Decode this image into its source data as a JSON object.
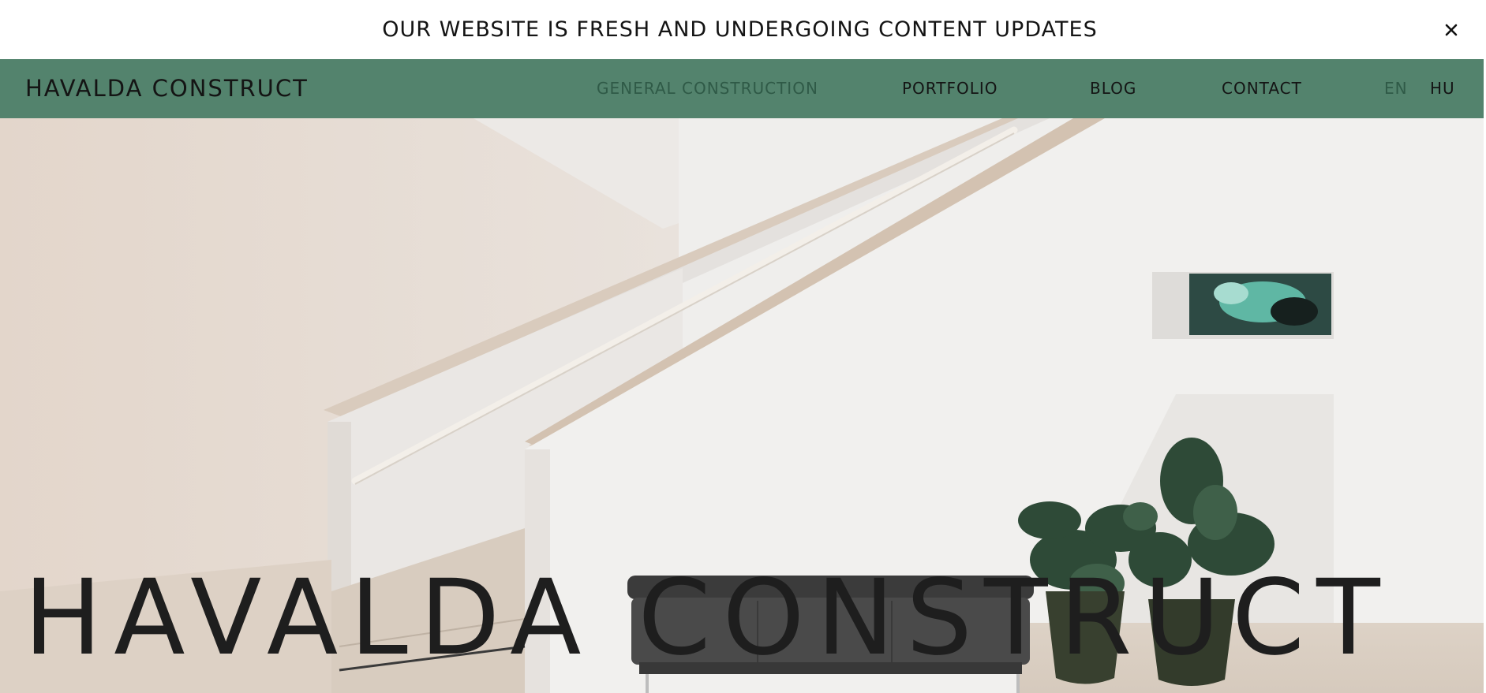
{
  "announcement": {
    "text": "OUR WEBSITE IS FRESH AND UNDERGOING CONTENT UPDATES",
    "close_icon": "close-icon"
  },
  "nav": {
    "logo": "HAVALDA CONSTRUCT",
    "links": [
      {
        "label": "GENERAL CONSTRUCTION",
        "active": true
      },
      {
        "label": "PORTFOLIO",
        "active": false
      },
      {
        "label": "BLOG",
        "active": false
      },
      {
        "label": "CONTACT",
        "active": false
      }
    ],
    "languages": [
      {
        "label": "EN",
        "selected": true
      },
      {
        "label": "HU",
        "selected": false
      }
    ]
  },
  "hero": {
    "title": "HAVALDA CONSTRUCT",
    "image": "interior-staircase-with-plants-and-bench"
  },
  "colors": {
    "nav_background": "#53836d",
    "announcement_background": "#ffffff",
    "text_dark": "#141414",
    "nav_active": "#2f5a47"
  }
}
